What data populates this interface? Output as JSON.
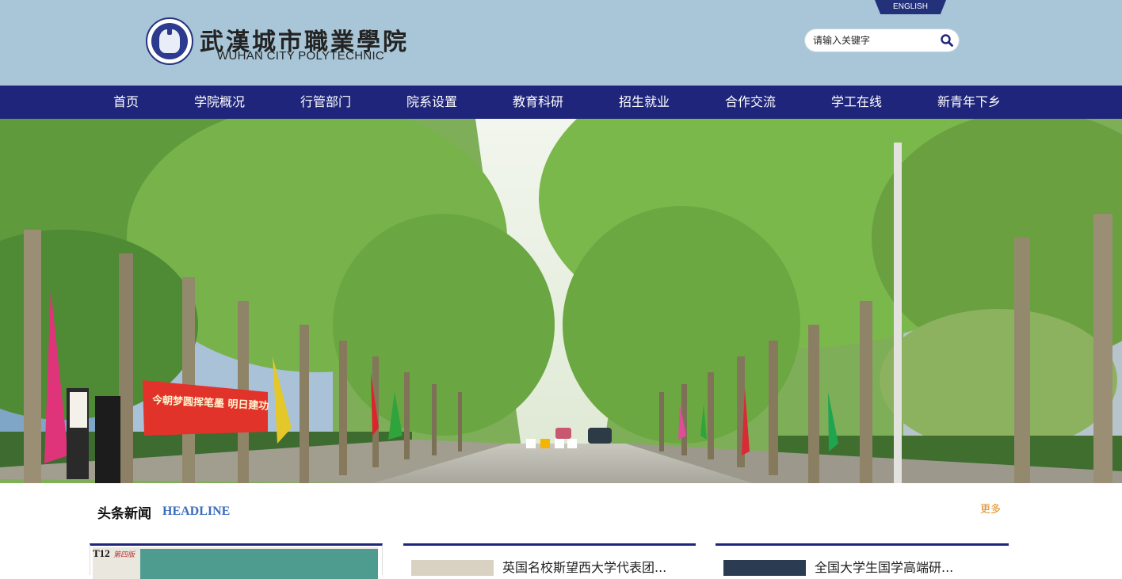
{
  "header": {
    "logo_cn": "武漢城市職業學院",
    "logo_en": "WUHAN CITY POLYTECHNIC",
    "english_link": "ENGLISH",
    "search_placeholder": "请输入关键字"
  },
  "nav": {
    "items": [
      "首页",
      "学院概况",
      "行管部门",
      "院系设置",
      "教育科研",
      "招生就业",
      "合作交流",
      "学工在线",
      "新青年下乡"
    ]
  },
  "hero": {
    "banner_text": "今朝梦圆挥笔墨 明日建功",
    "slide_count": 4,
    "active_slide": 2
  },
  "headline": {
    "title": "头条新闻",
    "subtitle": "HEADLINE",
    "more": "更多",
    "cards": [
      {
        "tag": "T12"
      },
      {
        "title": "英国名校斯望西大学代表团..."
      },
      {
        "title": "全国大学生国学高端研..."
      }
    ]
  },
  "colors": {
    "header_bg": "#a8c6d7",
    "nav_bg": "#1f257a",
    "accent": "#f4b400",
    "more_link": "#e08a1e"
  }
}
